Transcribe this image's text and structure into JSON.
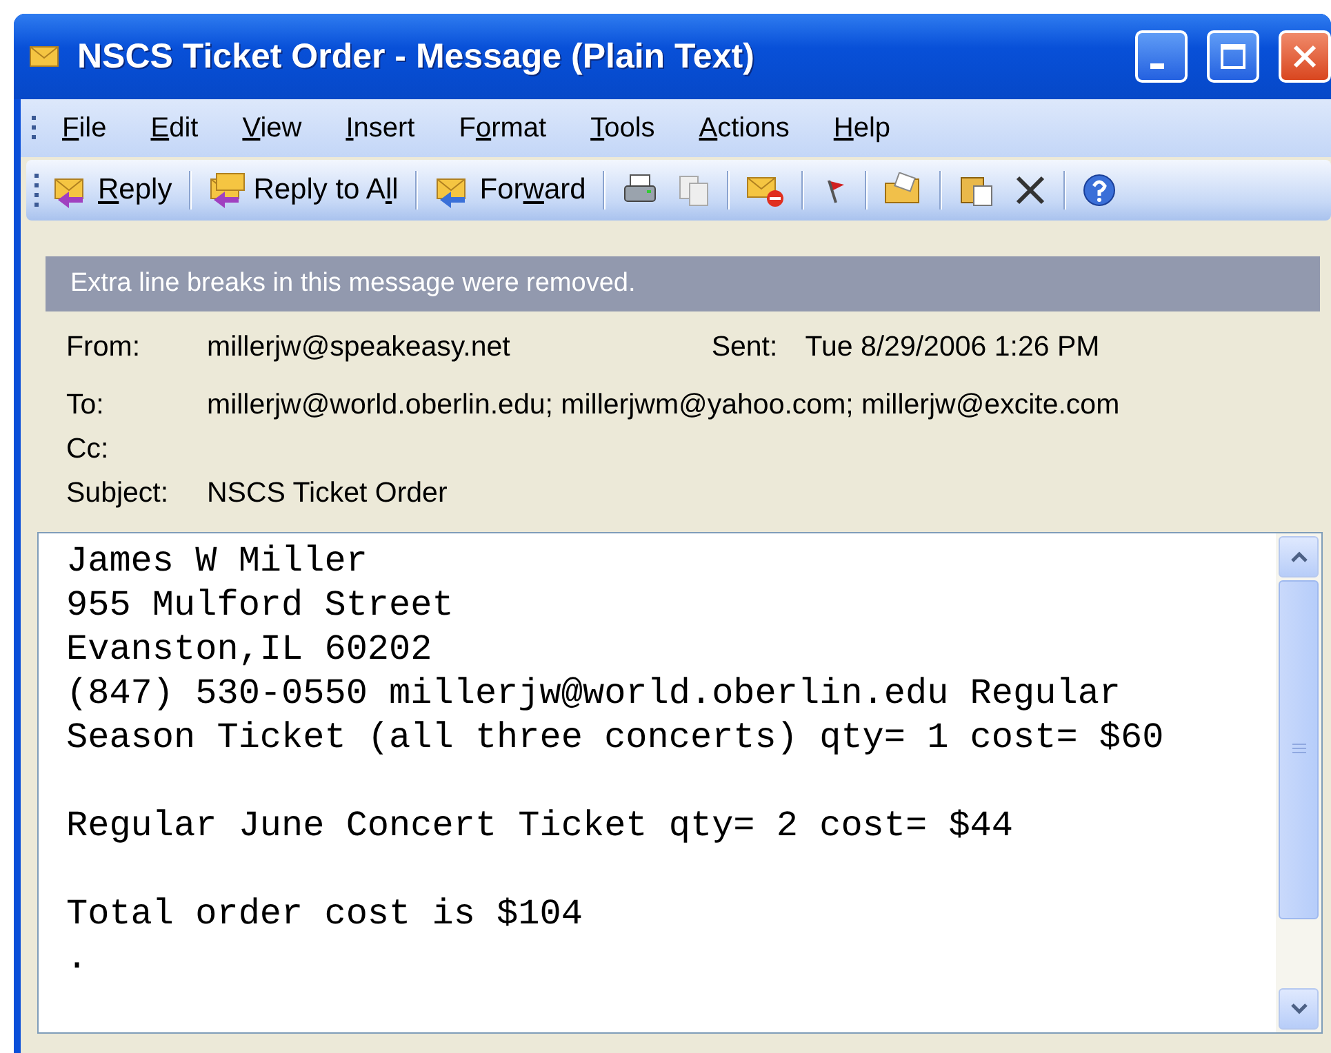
{
  "window": {
    "title": "NSCS Ticket Order - Message (Plain Text)"
  },
  "menu": [
    {
      "key": "F",
      "post": "ile"
    },
    {
      "key": "E",
      "post": "dit"
    },
    {
      "key": "V",
      "post": "iew"
    },
    {
      "key": "I",
      "post": "nsert"
    },
    {
      "pre": "F",
      "key": "o",
      "post": "rmat"
    },
    {
      "key": "T",
      "post": "ools"
    },
    {
      "key": "A",
      "post": "ctions"
    },
    {
      "key": "H",
      "post": "elp"
    }
  ],
  "toolbar": [
    {
      "key": "R",
      "post": "eply"
    },
    {
      "pre": "Reply to A",
      "key": "l",
      "post": "l"
    },
    {
      "pre": "For",
      "key": "w",
      "post": "ard"
    }
  ],
  "info_bar": "Extra line breaks in this message were removed.",
  "header": {
    "from_label": "From:",
    "from": "millerjw@speakeasy.net",
    "sent_label": "Sent:",
    "sent": "Tue 8/29/2006 1:26 PM",
    "to_label": "To:",
    "to": "millerjw@world.oberlin.edu; millerjwm@yahoo.com; millerjw@excite.com",
    "cc_label": "Cc:",
    "subject_label": "Subject:",
    "subject": "NSCS Ticket Order"
  },
  "body": [
    [
      "James W Miller",
      "955 Mulford Street",
      "Evanston,IL 60202",
      "(847) 530-0550 millerjw@world.oberlin.edu Regular",
      "Season Ticket (all three concerts) qty= 1 cost= $60"
    ],
    [
      "Regular June Concert Ticket qty= 2 cost= $44"
    ],
    [
      "Total order cost is $104",
      "."
    ]
  ]
}
